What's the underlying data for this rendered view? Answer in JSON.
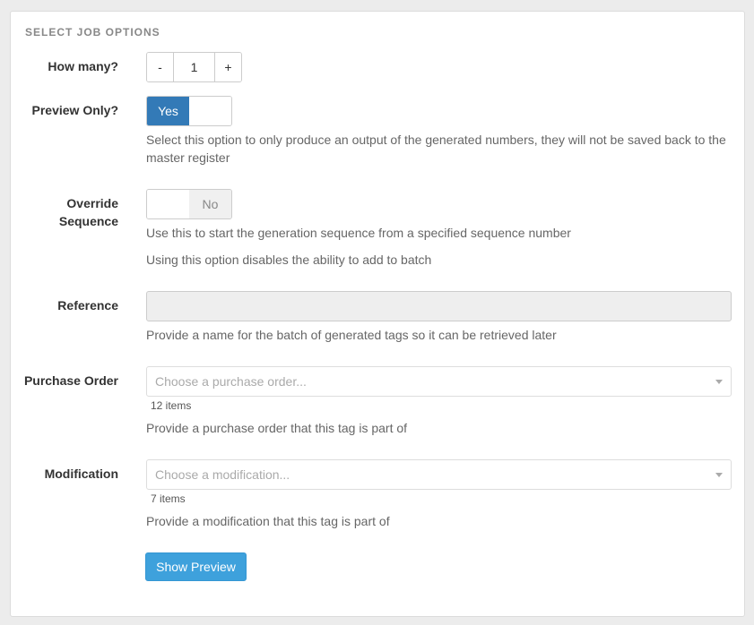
{
  "section_title": "SELECT JOB OPTIONS",
  "how_many": {
    "label": "How many?",
    "minus": "-",
    "value": "1",
    "plus": "+"
  },
  "preview_only": {
    "label": "Preview Only?",
    "state": "Yes",
    "help": "Select this option to only produce an output of the generated numbers, they will not be saved back to the master register"
  },
  "override_sequence": {
    "label_line1": "Override",
    "label_line2": "Sequence",
    "state": "No",
    "help1": "Use this to start the generation sequence from a specified sequence number",
    "help2": "Using this option disables the ability to add to batch"
  },
  "reference": {
    "label": "Reference",
    "value": "",
    "help": "Provide a name for the batch of generated tags so it can be retrieved later"
  },
  "purchase_order": {
    "label": "Purchase Order",
    "placeholder": "Choose a purchase order...",
    "count": "12 items",
    "help": "Provide a purchase order that this tag is part of"
  },
  "modification": {
    "label": "Modification",
    "placeholder": "Choose a modification...",
    "count": "7 items",
    "help": "Provide a modification that this tag is part of"
  },
  "show_preview_label": "Show Preview",
  "colors": {
    "toggle_on": "#337ab7",
    "primary_button": "#3ea1dc",
    "background": "#ececec"
  }
}
